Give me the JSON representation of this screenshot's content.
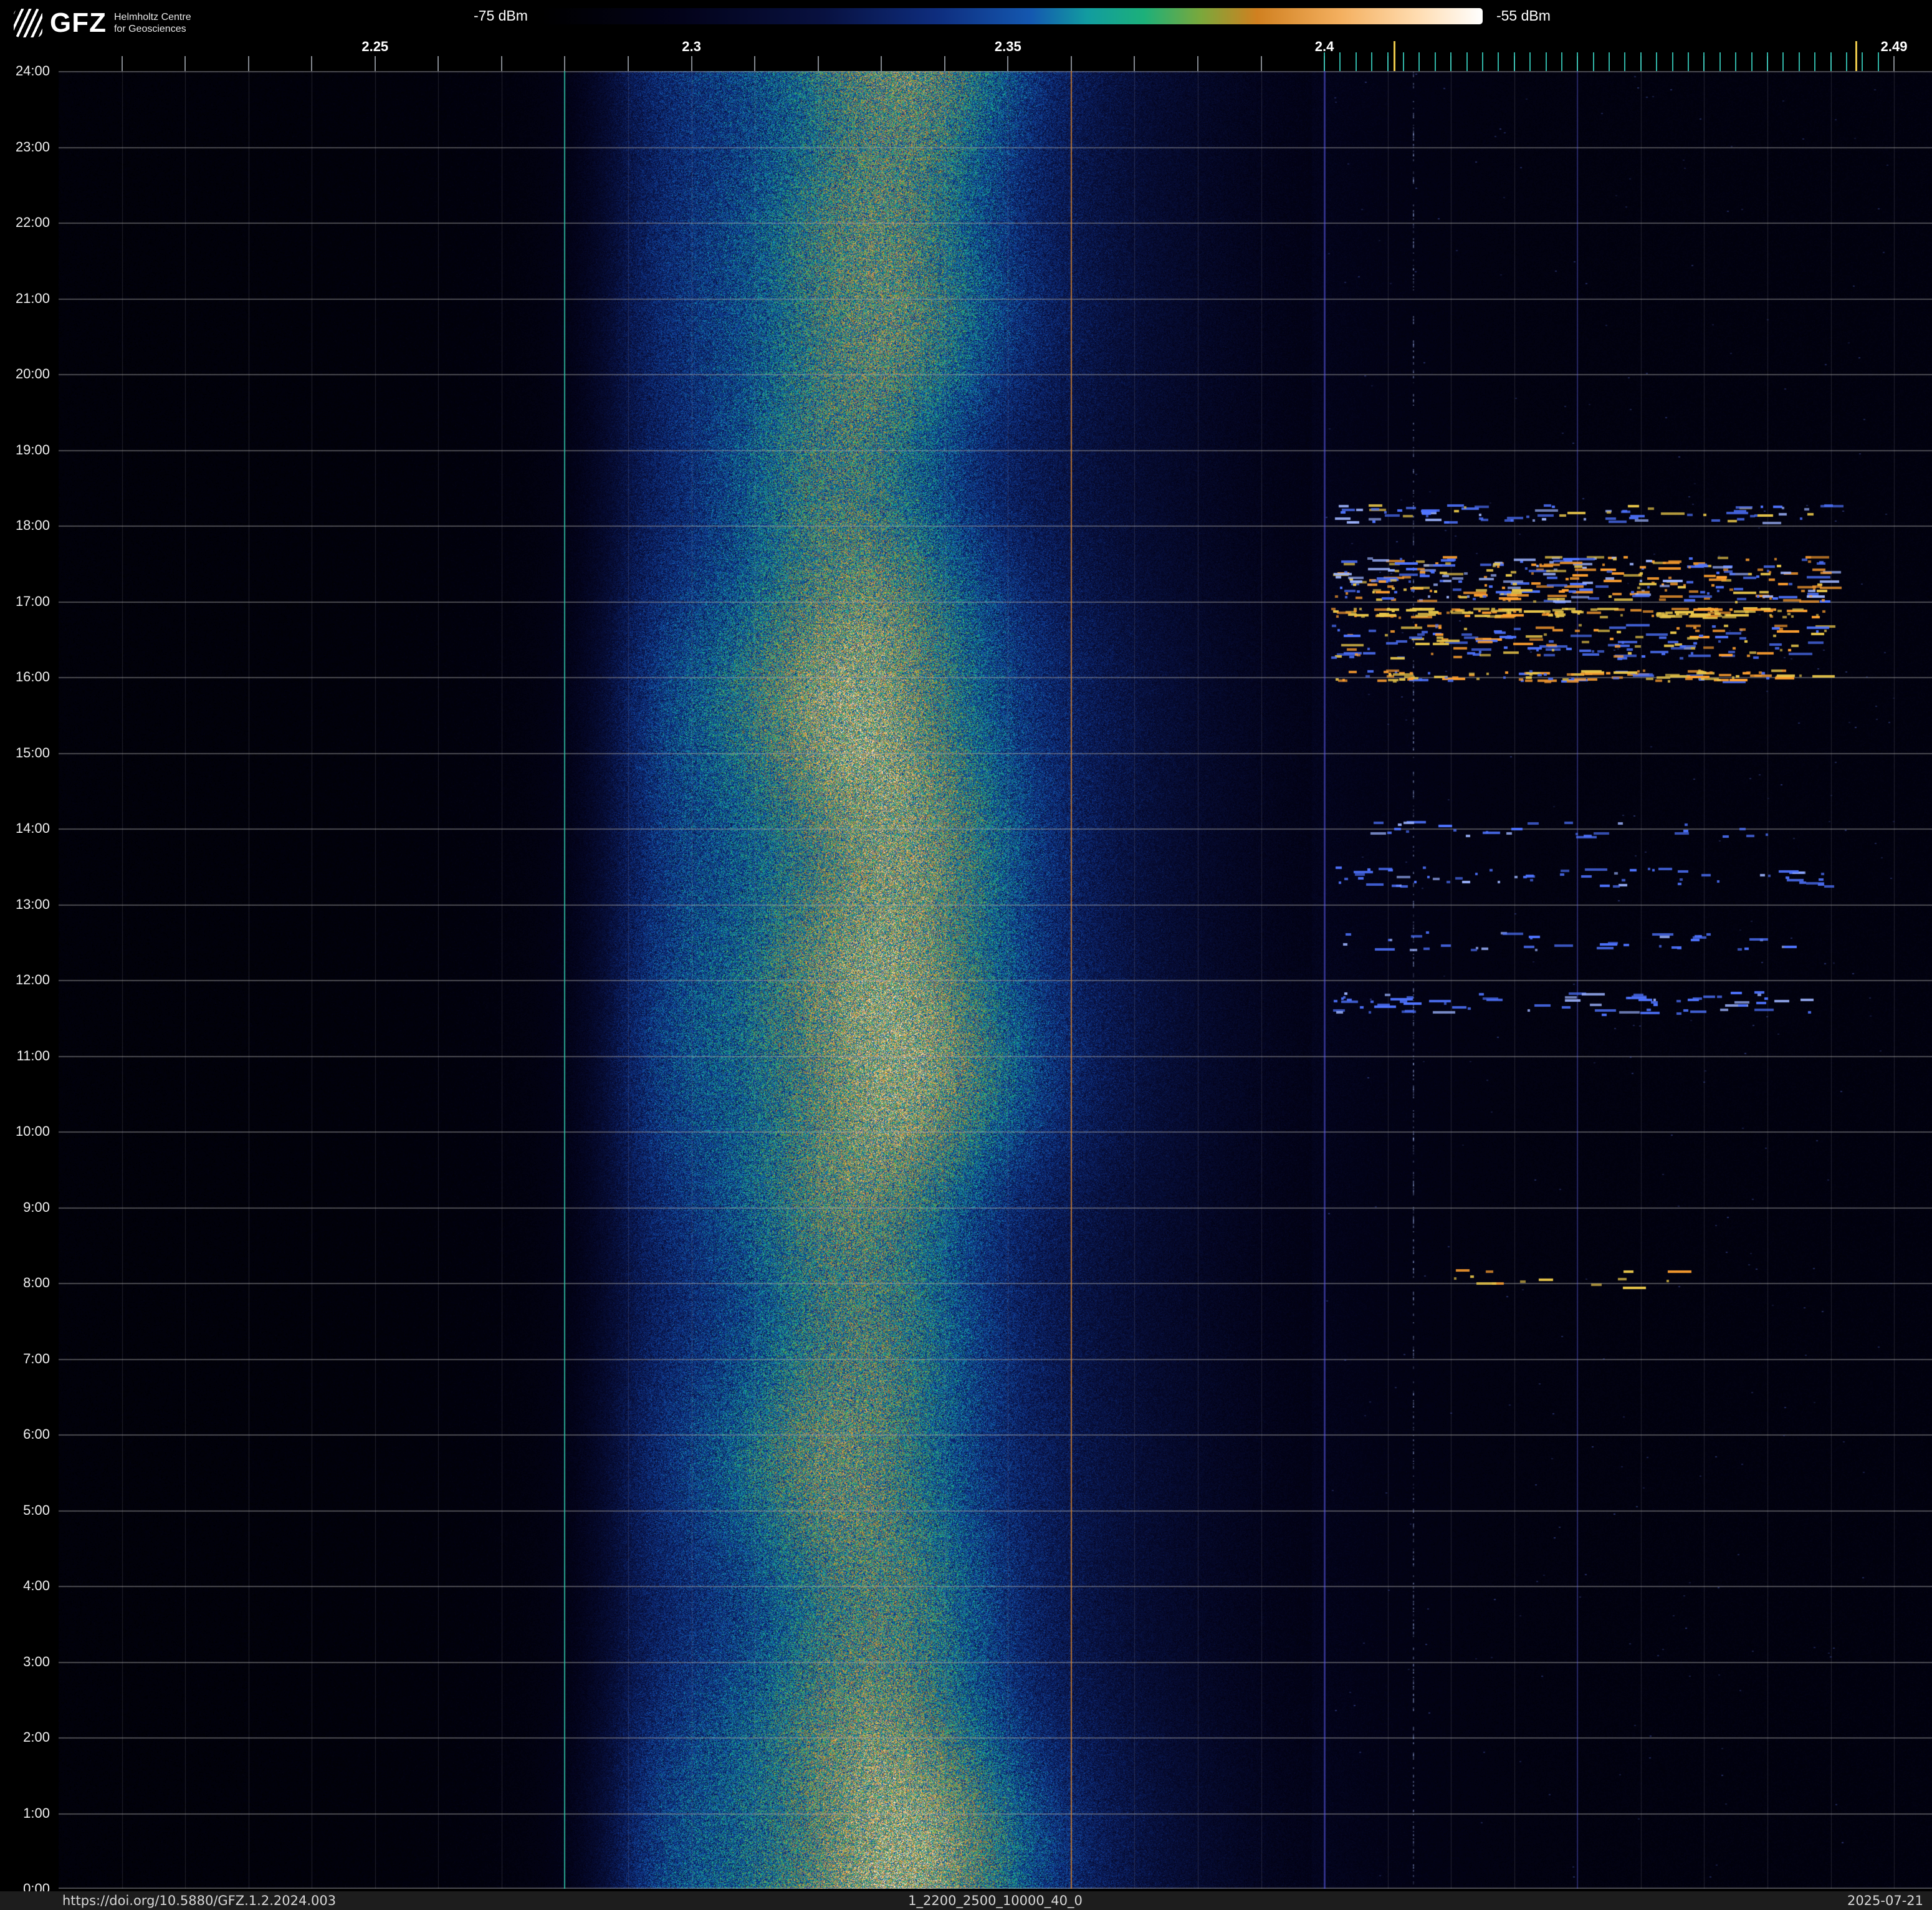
{
  "branding": {
    "logo_text": "GFZ",
    "sub_line1": "Helmholtz Centre",
    "sub_line2": "for Geosciences"
  },
  "colorbar": {
    "min_label": "-75 dBm",
    "max_label": "-55 dBm"
  },
  "footer": {
    "doi": "https://doi.org/10.5880/GFZ.1.2.2024.003",
    "dataset_id": "1_2200_2500_10000_40_0",
    "date": "2025-07-21"
  },
  "chart_data": {
    "type": "heatmap",
    "description": "24-hour radio-frequency spectrogram (waterfall): frequency 2.2-2.5 GHz on x-axis, time of day on y-axis (24:00 top to 0:00 bottom), received power colour-coded from -75 dBm to -55 dBm. Broad noise band centred near 2.33 GHz all day; Wi-Fi burst activity between 2.40 and 2.48 GHz mainly around 16:00-18:30, 11:30-14:00 and 8:00.",
    "x_unit": "GHz",
    "x_range": [
      2.2,
      2.496
    ],
    "x_major_ticks": [
      {
        "value": 2.25,
        "label": "2.25"
      },
      {
        "value": 2.3,
        "label": "2.3"
      },
      {
        "value": 2.35,
        "label": "2.35"
      },
      {
        "value": 2.4,
        "label": "2.4"
      },
      {
        "value": 2.49,
        "label": "2.49"
      }
    ],
    "x_minor_ticks": {
      "start": 2.21,
      "end": 2.49,
      "step": 0.01
    },
    "wifi_channel_ticks": {
      "start": 2.4,
      "end": 2.488,
      "step": 0.0025,
      "color": "#35c8b8",
      "highlights": [
        {
          "value": 2.411,
          "color": "#e8c64a"
        },
        {
          "value": 2.484,
          "color": "#e8c64a"
        }
      ]
    },
    "y_unit": "time of day",
    "y_tick_labels": [
      "24:00",
      "23:00",
      "22:00",
      "21:00",
      "20:00",
      "19:00",
      "18:00",
      "17:00",
      "16:00",
      "15:00",
      "14:00",
      "13:00",
      "12:00",
      "11:00",
      "10:00",
      "9:00",
      "8:00",
      "7:00",
      "6:00",
      "5:00",
      "4:00",
      "3:00",
      "2:00",
      "1:00",
      "0:00"
    ],
    "color_scale": {
      "min_dbm": -75,
      "max_dbm": -55,
      "stops": [
        [
          0.0,
          "#000000"
        ],
        [
          0.15,
          "#03031a"
        ],
        [
          0.3,
          "#081140"
        ],
        [
          0.42,
          "#0e2d7e"
        ],
        [
          0.52,
          "#1458b0"
        ],
        [
          0.58,
          "#129ca0"
        ],
        [
          0.64,
          "#1cb07a"
        ],
        [
          0.7,
          "#7aa83c"
        ],
        [
          0.76,
          "#d08020"
        ],
        [
          0.85,
          "#f4b060"
        ],
        [
          0.93,
          "#ffdcb0"
        ],
        [
          1.0,
          "#ffffff"
        ]
      ]
    },
    "noise_band": {
      "left_edge_ghz": 2.287,
      "right_fade_ghz": 2.37,
      "plateau_amp": 0.33,
      "mid_center_ghz": 2.332,
      "mid_sigma": 0.035,
      "mid_amp": 0.11,
      "core_center_ghz": 2.329,
      "core_sigma": 0.0125,
      "core_amp": 0.24,
      "core_wobble_ghz": 0.0035
    },
    "marker_lines": [
      {
        "f": 2.28,
        "color": "rgba(45,185,160,0.9)",
        "width": 2
      },
      {
        "f": 2.36,
        "color": "rgba(205,125,45,0.85)",
        "width": 2
      },
      {
        "f": 2.4,
        "color": "rgba(80,80,230,0.5)",
        "width": 3
      },
      {
        "f": 2.44,
        "color": "rgba(80,80,230,0.35)",
        "width": 2
      }
    ],
    "dotted_column": {
      "f": 2.414,
      "color": "#8ea0d8",
      "count": 520
    },
    "sparse_dots": {
      "f": [
        2.4,
        2.49
      ],
      "count": 320,
      "color": "#4f63c8"
    },
    "grid": {
      "hour_line_color": "rgba(165,165,165,0.45)",
      "minor_v_color": "rgba(150,150,160,0.22)"
    },
    "wifi_events": [
      {
        "t": [
          18.05,
          18.3
        ],
        "f": [
          2.401,
          2.479
        ],
        "count": 80,
        "palette": [
          "#4f74ff",
          "#9db4ff",
          "#e8c64a"
        ],
        "weights": [
          0.6,
          0.25,
          0.15
        ]
      },
      {
        "t": [
          17.0,
          17.6
        ],
        "f": [
          2.401,
          2.479
        ],
        "count": 320,
        "palette": [
          "#ffa030",
          "#e8c64a",
          "#4f74ff",
          "#9db4ff"
        ],
        "weights": [
          0.35,
          0.2,
          0.3,
          0.15
        ]
      },
      {
        "t": [
          16.8,
          16.92
        ],
        "f": [
          2.401,
          2.479
        ],
        "count": 150,
        "palette": [
          "#e8c64a",
          "#ffa030"
        ],
        "weights": [
          0.6,
          0.4
        ]
      },
      {
        "t": [
          16.25,
          16.7
        ],
        "f": [
          2.401,
          2.479
        ],
        "count": 170,
        "palette": [
          "#4f74ff",
          "#ffa030",
          "#e8c64a"
        ],
        "weights": [
          0.5,
          0.3,
          0.2
        ]
      },
      {
        "t": [
          15.95,
          16.1
        ],
        "f": [
          2.401,
          2.479
        ],
        "count": 120,
        "palette": [
          "#e8c64a",
          "#ffa030",
          "#4f74ff"
        ],
        "weights": [
          0.45,
          0.35,
          0.2
        ]
      },
      {
        "t": [
          13.9,
          14.1
        ],
        "f": [
          2.405,
          2.47
        ],
        "count": 30,
        "palette": [
          "#4f74ff",
          "#9db4ff"
        ],
        "weights": [
          0.7,
          0.3
        ]
      },
      {
        "t": [
          13.25,
          13.5
        ],
        "f": [
          2.401,
          2.479
        ],
        "count": 60,
        "palette": [
          "#4f74ff",
          "#9db4ff"
        ],
        "weights": [
          0.7,
          0.3
        ]
      },
      {
        "t": [
          12.4,
          12.65
        ],
        "f": [
          2.401,
          2.475
        ],
        "count": 40,
        "palette": [
          "#4f74ff",
          "#9db4ff"
        ],
        "weights": [
          0.7,
          0.3
        ]
      },
      {
        "t": [
          11.55,
          11.85
        ],
        "f": [
          2.401,
          2.479
        ],
        "count": 70,
        "palette": [
          "#4f74ff",
          "#9db4ff"
        ],
        "weights": [
          0.75,
          0.25
        ]
      },
      {
        "t": [
          7.95,
          8.2
        ],
        "f": [
          2.42,
          2.46
        ],
        "count": 14,
        "palette": [
          "#e8c64a",
          "#ffa030"
        ],
        "weights": [
          0.6,
          0.4
        ]
      }
    ]
  }
}
